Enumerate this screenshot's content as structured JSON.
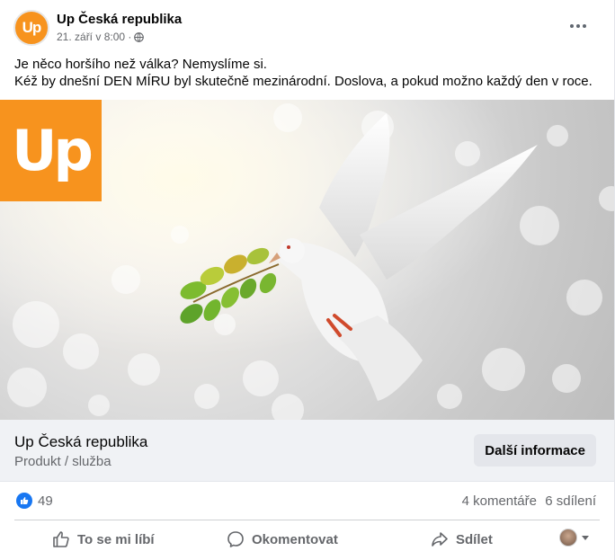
{
  "post": {
    "page_name": "Up Česká republika",
    "avatar_text": "Up",
    "timestamp": "21. září v 8:00 ·",
    "privacy_icon": "globe-icon",
    "more_icon": "more-options-icon",
    "text_line1": "Je něco horšího než válka? Nemyslíme si.",
    "text_line2": "Kéž by dnešní DEN MÍRU byl skutečně mezinárodní. Doslova, a pokud možno každý den v roce."
  },
  "media": {
    "logo_text": "Up",
    "brand_color": "#f7931e"
  },
  "link": {
    "title": "Up Česká republika",
    "subtitle": "Produkt / služba",
    "cta_label": "Další informace"
  },
  "stats": {
    "likes": "49",
    "comments": "4 komentáře",
    "shares": "6 sdílení"
  },
  "actions": {
    "like": "To se mi líbí",
    "comment": "Okomentovat",
    "share": "Sdílet"
  },
  "colors": {
    "accent": "#1877f2",
    "secondary_text": "#65676b",
    "link_bg": "#f0f2f5"
  }
}
